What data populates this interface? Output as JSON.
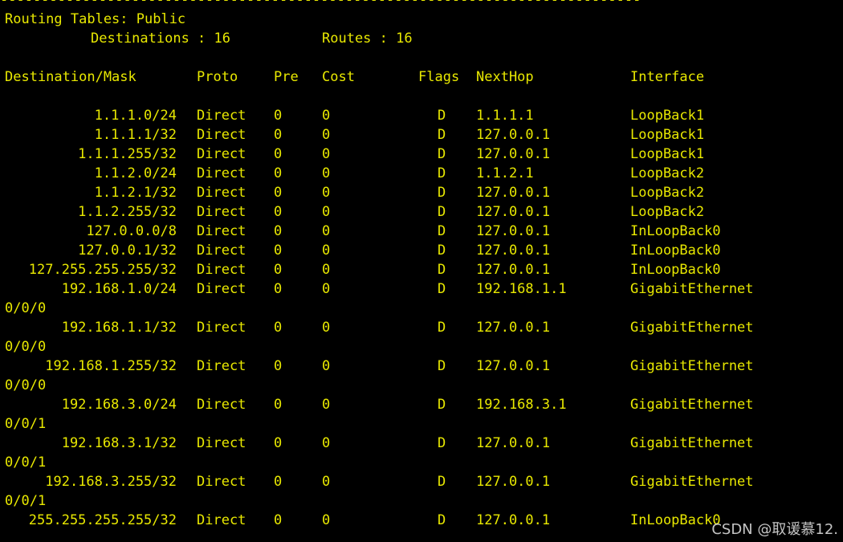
{
  "terminal": {
    "separator": "------------------------------------------------------------------------------",
    "title": "Routing Tables: Public",
    "destinations_label": "Destinations : 16",
    "routes_label": "Routes : 16",
    "headers": {
      "dest": "Destination/Mask",
      "proto": "Proto",
      "pre": "Pre",
      "cost": "Cost",
      "flags": "Flags",
      "nexthop": "NextHop",
      "iface": "Interface"
    },
    "rows": [
      {
        "dest": "1.1.1.0/24",
        "proto": "Direct",
        "pre": "0",
        "cost": "0",
        "flags": "D",
        "nexthop": "1.1.1.1",
        "iface": "LoopBack1",
        "iface2": ""
      },
      {
        "dest": "1.1.1.1/32",
        "proto": "Direct",
        "pre": "0",
        "cost": "0",
        "flags": "D",
        "nexthop": "127.0.0.1",
        "iface": "LoopBack1",
        "iface2": ""
      },
      {
        "dest": "1.1.1.255/32",
        "proto": "Direct",
        "pre": "0",
        "cost": "0",
        "flags": "D",
        "nexthop": "127.0.0.1",
        "iface": "LoopBack1",
        "iface2": ""
      },
      {
        "dest": "1.1.2.0/24",
        "proto": "Direct",
        "pre": "0",
        "cost": "0",
        "flags": "D",
        "nexthop": "1.1.2.1",
        "iface": "LoopBack2",
        "iface2": ""
      },
      {
        "dest": "1.1.2.1/32",
        "proto": "Direct",
        "pre": "0",
        "cost": "0",
        "flags": "D",
        "nexthop": "127.0.0.1",
        "iface": "LoopBack2",
        "iface2": ""
      },
      {
        "dest": "1.1.2.255/32",
        "proto": "Direct",
        "pre": "0",
        "cost": "0",
        "flags": "D",
        "nexthop": "127.0.0.1",
        "iface": "LoopBack2",
        "iface2": ""
      },
      {
        "dest": "127.0.0.0/8",
        "proto": "Direct",
        "pre": "0",
        "cost": "0",
        "flags": "D",
        "nexthop": "127.0.0.1",
        "iface": "InLoopBack0",
        "iface2": ""
      },
      {
        "dest": "127.0.0.1/32",
        "proto": "Direct",
        "pre": "0",
        "cost": "0",
        "flags": "D",
        "nexthop": "127.0.0.1",
        "iface": "InLoopBack0",
        "iface2": ""
      },
      {
        "dest": "127.255.255.255/32",
        "proto": "Direct",
        "pre": "0",
        "cost": "0",
        "flags": "D",
        "nexthop": "127.0.0.1",
        "iface": "InLoopBack0",
        "iface2": ""
      },
      {
        "dest": "192.168.1.0/24",
        "proto": "Direct",
        "pre": "0",
        "cost": "0",
        "flags": "D",
        "nexthop": "192.168.1.1",
        "iface": "GigabitEthernet",
        "iface2": "0/0/0"
      },
      {
        "dest": "192.168.1.1/32",
        "proto": "Direct",
        "pre": "0",
        "cost": "0",
        "flags": "D",
        "nexthop": "127.0.0.1",
        "iface": "GigabitEthernet",
        "iface2": "0/0/0"
      },
      {
        "dest": "192.168.1.255/32",
        "proto": "Direct",
        "pre": "0",
        "cost": "0",
        "flags": "D",
        "nexthop": "127.0.0.1",
        "iface": "GigabitEthernet",
        "iface2": "0/0/0"
      },
      {
        "dest": "192.168.3.0/24",
        "proto": "Direct",
        "pre": "0",
        "cost": "0",
        "flags": "D",
        "nexthop": "192.168.3.1",
        "iface": "GigabitEthernet",
        "iface2": "0/0/1"
      },
      {
        "dest": "192.168.3.1/32",
        "proto": "Direct",
        "pre": "0",
        "cost": "0",
        "flags": "D",
        "nexthop": "127.0.0.1",
        "iface": "GigabitEthernet",
        "iface2": "0/0/1"
      },
      {
        "dest": "192.168.3.255/32",
        "proto": "Direct",
        "pre": "0",
        "cost": "0",
        "flags": "D",
        "nexthop": "127.0.0.1",
        "iface": "GigabitEthernet",
        "iface2": "0/0/1"
      },
      {
        "dest": "255.255.255.255/32",
        "proto": "Direct",
        "pre": "0",
        "cost": "0",
        "flags": "D",
        "nexthop": "127.0.0.1",
        "iface": "InLoopBack0",
        "iface2": ""
      }
    ]
  },
  "watermark": "CSDN @取谖慕12.",
  "colors": {
    "background": "#000000",
    "text": "#e8e800"
  }
}
